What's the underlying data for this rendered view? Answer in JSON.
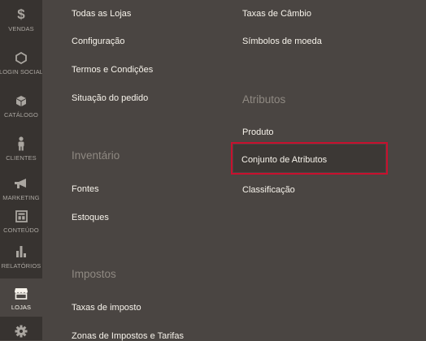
{
  "sidebar": {
    "items": [
      {
        "label": "VENDAS",
        "icon": "dollar-icon"
      },
      {
        "label": "LOGIN SOCIAL",
        "icon": "hexagon-icon"
      },
      {
        "label": "CATÁLOGO",
        "icon": "cube-icon"
      },
      {
        "label": "CLIENTES",
        "icon": "person-icon"
      },
      {
        "label": "MARKETING",
        "icon": "megaphone-icon"
      },
      {
        "label": "CONTEÚDO",
        "icon": "layout-icon"
      },
      {
        "label": "RELATÓRIOS",
        "icon": "bar-chart-icon"
      },
      {
        "label": "LOJAS",
        "icon": "store-icon",
        "active": true
      },
      {
        "label": "",
        "icon": "gear-icon"
      }
    ]
  },
  "menu": {
    "column1": {
      "settings_links": [
        "Todas as Lojas",
        "Configuração",
        "Termos e Condições",
        "Situação do pedido"
      ],
      "inventory_heading": "Inventário",
      "inventory_links": [
        "Fontes",
        "Estoques"
      ],
      "taxes_heading": "Impostos",
      "taxes_links": [
        "Taxas de imposto",
        "Zonas de Impostos e Tarifas"
      ]
    },
    "column2": {
      "currency_links": [
        "Taxas de Câmbio",
        "Símbolos de moeda"
      ],
      "attributes_heading": "Atributos",
      "attributes_links": [
        "Produto",
        "Conjunto de Atributos",
        "Classificação"
      ]
    },
    "highlight_color": "#c8102e"
  }
}
